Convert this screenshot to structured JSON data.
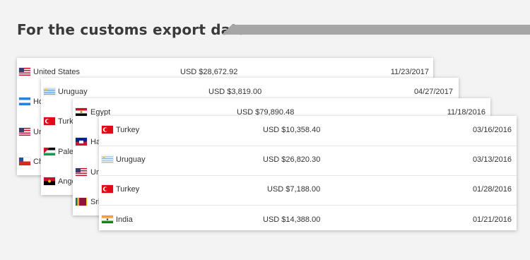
{
  "header": {
    "title": "For the customs export data"
  },
  "colors": {
    "header_bar": "#a6a6a6",
    "background": "#f3f3f3"
  },
  "panels": [
    {
      "rows": [
        {
          "flag_icon": "us-flag-icon",
          "country": "United States",
          "amount": "USD $28,672.92",
          "date": "11/23/2017"
        },
        {
          "flag_icon": "hn-flag-icon",
          "country": "Ho"
        },
        {
          "flag_icon": "us-flag-icon",
          "country": "Un"
        },
        {
          "flag_icon": "cl-flag-icon",
          "country": "Ch"
        }
      ]
    },
    {
      "rows": [
        {
          "flag_icon": "uy-flag-icon",
          "country": "Uruguay",
          "amount": "USD $3,819.00",
          "date": "04/27/2017"
        },
        {
          "flag_icon": "tr-flag-icon",
          "country": "Turk"
        },
        {
          "flag_icon": "ps-flag-icon",
          "country": "Pales"
        },
        {
          "flag_icon": "ao-flag-icon",
          "country": "Ango"
        }
      ]
    },
    {
      "rows": [
        {
          "flag_icon": "eg-flag-icon",
          "country": "Egypt",
          "amount": "USD $79,890.48",
          "date": "11/18/2016"
        },
        {
          "flag_icon": "ht-flag-icon",
          "country": "Ha"
        },
        {
          "flag_icon": "us-flag-icon",
          "country": "Un"
        },
        {
          "flag_icon": "lk-flag-icon",
          "country": "Sri"
        }
      ]
    },
    {
      "rows": [
        {
          "flag_icon": "tr-flag-icon",
          "country": "Turkey",
          "amount": "USD $10,358.40",
          "date": "03/16/2016"
        },
        {
          "flag_icon": "uy-flag-icon",
          "country": "Uruguay",
          "amount": "USD $26,820.30",
          "date": "03/13/2016"
        },
        {
          "flag_icon": "tr-flag-icon",
          "country": "Turkey",
          "amount": "USD $7,188.00",
          "date": "01/28/2016"
        },
        {
          "flag_icon": "in-flag-icon",
          "country": "India",
          "amount": "USD $14,388.00",
          "date": "01/21/2016"
        }
      ]
    }
  ]
}
